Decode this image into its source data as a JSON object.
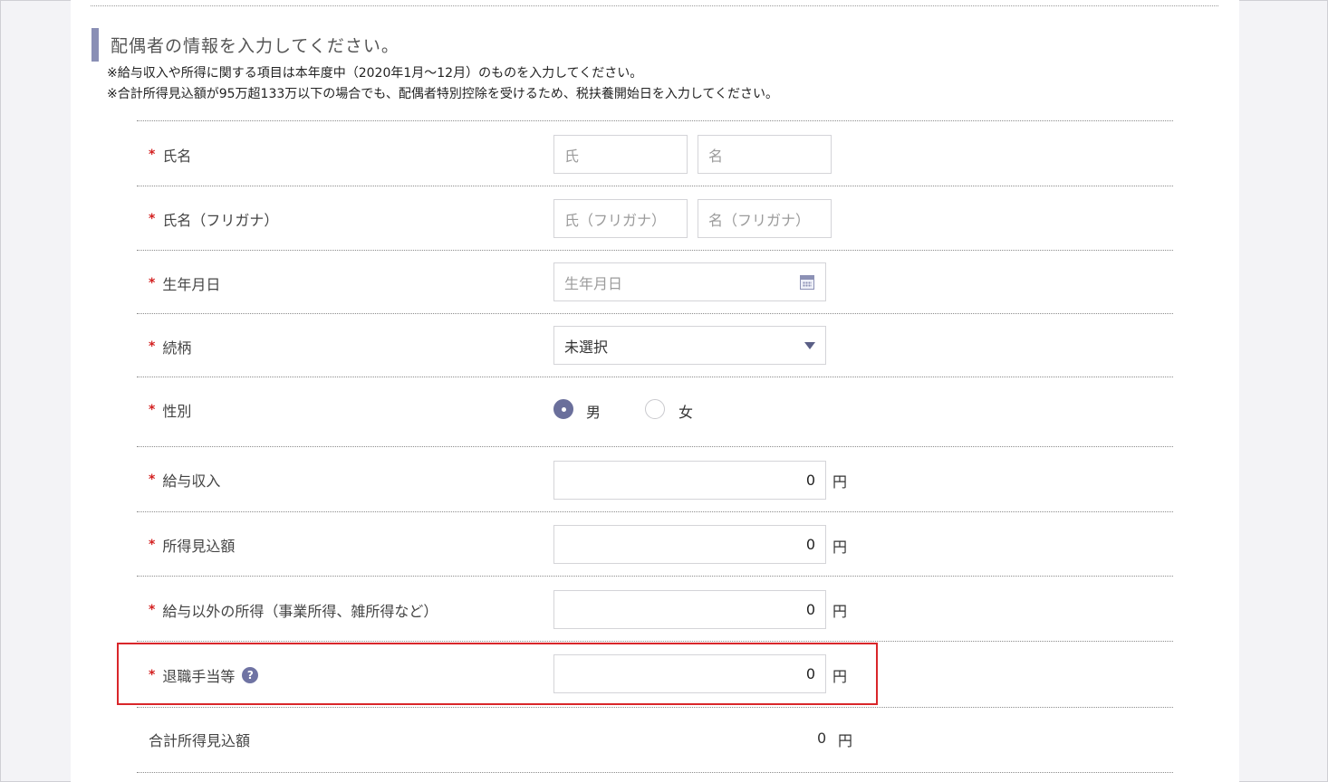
{
  "section": {
    "title": "配偶者の情報を入力してください。",
    "note1": "※給与収入や所得に関する項目は本年度中（2020年1月〜12月）のものを入力してください。",
    "note2": "※合計所得見込額が95万超133万以下の場合でも、配偶者特別控除を受けるため、税扶養開始日を入力してください。"
  },
  "required_mark": "*",
  "fields": {
    "name": {
      "label": "氏名",
      "last_placeholder": "氏",
      "first_placeholder": "名"
    },
    "kana": {
      "label": "氏名（フリガナ）",
      "last_placeholder": "氏（フリガナ）",
      "first_placeholder": "名（フリガナ）"
    },
    "birthdate": {
      "label": "生年月日",
      "placeholder": "生年月日",
      "icon": "calendar-icon"
    },
    "relation": {
      "label": "続柄",
      "selected": "未選択",
      "icon": "chevron-down-icon"
    },
    "gender": {
      "label": "性別",
      "options": [
        "男",
        "女"
      ],
      "selected_index": 0
    },
    "salary_income": {
      "label": "給与収入",
      "value": "0",
      "unit": "円"
    },
    "expected_income": {
      "label": "所得見込額",
      "value": "0",
      "unit": "円"
    },
    "other_income": {
      "label": "給与以外の所得（事業所得、雑所得など）",
      "value": "0",
      "unit": "円"
    },
    "retirement_allowance": {
      "label": "退職手当等",
      "value": "0",
      "unit": "円",
      "help": "?"
    },
    "total_income": {
      "label": "合計所得見込額",
      "value": "0",
      "unit": "円"
    }
  },
  "colors": {
    "accent": "#6a6f9b",
    "required": "#d32020",
    "highlight_border": "#d9262a"
  }
}
